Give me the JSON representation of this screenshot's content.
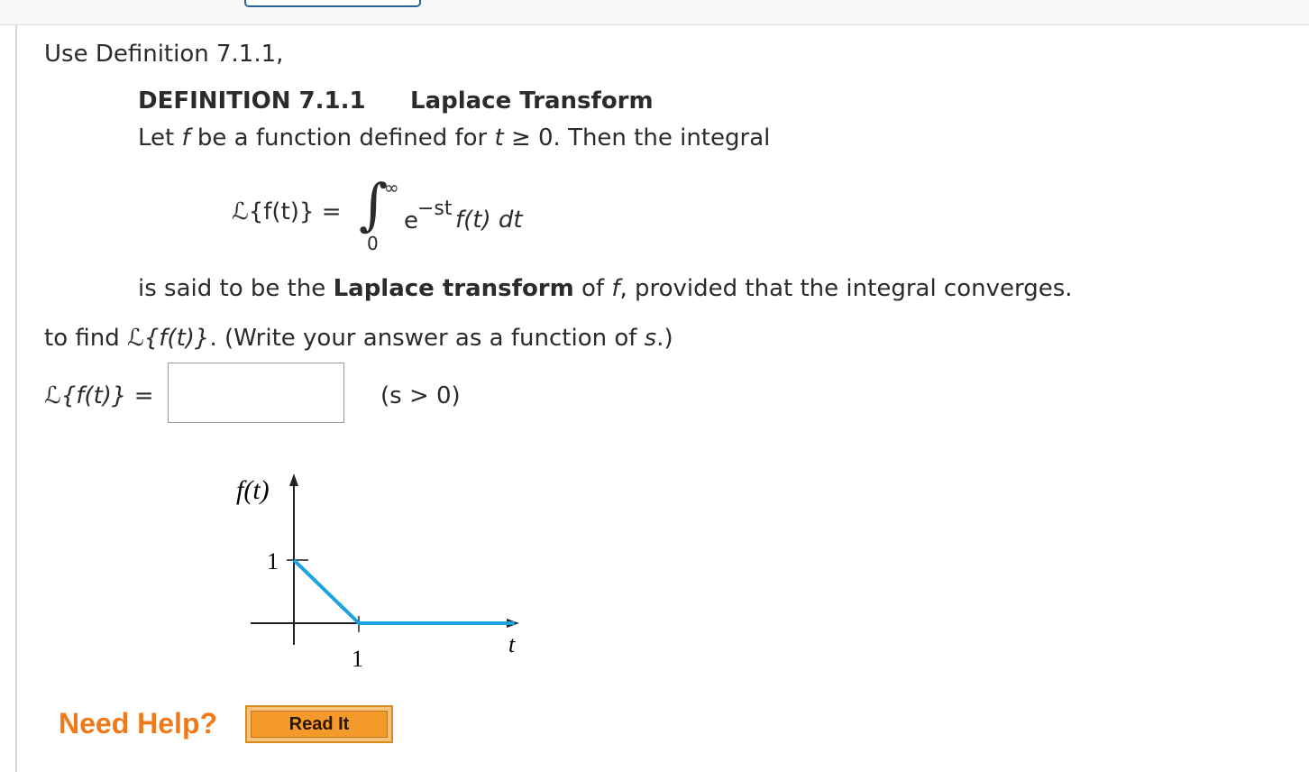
{
  "intro": "Use Definition 7.1.1,",
  "definition": {
    "number": "DEFINITION 7.1.1",
    "title": "Laplace Transform",
    "line1": {
      "a": "Let ",
      "f": "f",
      "b": " be a function defined for ",
      "t": "t",
      "c": " ≥ 0. Then the integral"
    },
    "formula": {
      "lhs": "ℒ{f(t)} =",
      "integral": "∫",
      "upper": "∞",
      "lower": "0",
      "base": "e",
      "exp": "−st",
      "rest": "f(t) dt"
    },
    "line2": {
      "a": "is said to be the ",
      "b": "Laplace transform",
      "c": " of ",
      "f": "f",
      "d": ", provided that the integral converges."
    }
  },
  "task": {
    "a": "to find ",
    "b": "ℒ{f(t)}",
    "c": ". (Write your answer as a function of ",
    "s": "s",
    "d": ".)"
  },
  "answer": {
    "label": "ℒ{f(t)} =",
    "value": "",
    "condition": "(s > 0)"
  },
  "graph": {
    "y_label": "f(t)",
    "x_label": "t",
    "y_tick": "1",
    "x_tick": "1",
    "line_color": "#1aa3e0",
    "points": [
      [
        0,
        1
      ],
      [
        1,
        0
      ],
      [
        3.4,
        0
      ]
    ]
  },
  "help": {
    "label": "Need Help?",
    "button": "Read It"
  },
  "colors": {
    "help": "#f07a1a",
    "button": "#f39a2b",
    "top_tab_border": "#2a6496"
  }
}
